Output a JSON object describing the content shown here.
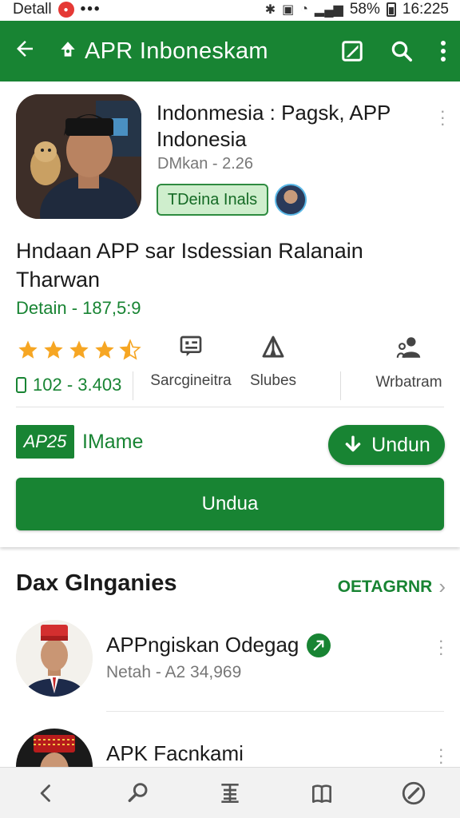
{
  "status_bar": {
    "left_text": "Detall",
    "badge_icon": "notification-badge-icon",
    "dots": "•••",
    "battery": "58%",
    "time": "16:225"
  },
  "app_bar": {
    "title": "APR Inboneskam",
    "back_icon": "arrow-back-icon",
    "app_icon": "android-icon",
    "actions": [
      "edit-icon",
      "search-icon",
      "more-vert-icon"
    ],
    "color": "#188433"
  },
  "app_header": {
    "title": "Indonmesia : Pagsk, APP Indonesia",
    "subtitle": "DMkan - 2.26",
    "tag": "TDeina Inals"
  },
  "description": {
    "text": "Hndaan APP sar Isdessian Ralanain Tharwan",
    "sub": "Detain - 187,5:9"
  },
  "stats": {
    "rating": 4.5,
    "rating_count": "102 - 3.403",
    "col1_label": "Sarcgineitra",
    "col2_label": "Slubes",
    "col3_label": "Wrbatram"
  },
  "apk_row": {
    "badge": "AP25",
    "name": "IMame",
    "small_button": "Undun",
    "big_button": "Undua"
  },
  "section": {
    "title": "Dax GInganies",
    "link": "OETAGRNR"
  },
  "list": [
    {
      "title": "APPngiskan Odegag",
      "sub": "Netah - A2 34,969",
      "verified": true
    },
    {
      "title": "APK Facnkami",
      "sub": "",
      "verified": false
    }
  ],
  "bottom_nav": [
    "back-nav-icon",
    "search-nav-icon",
    "list-nav-icon",
    "library-nav-icon",
    "explore-nav-icon"
  ]
}
